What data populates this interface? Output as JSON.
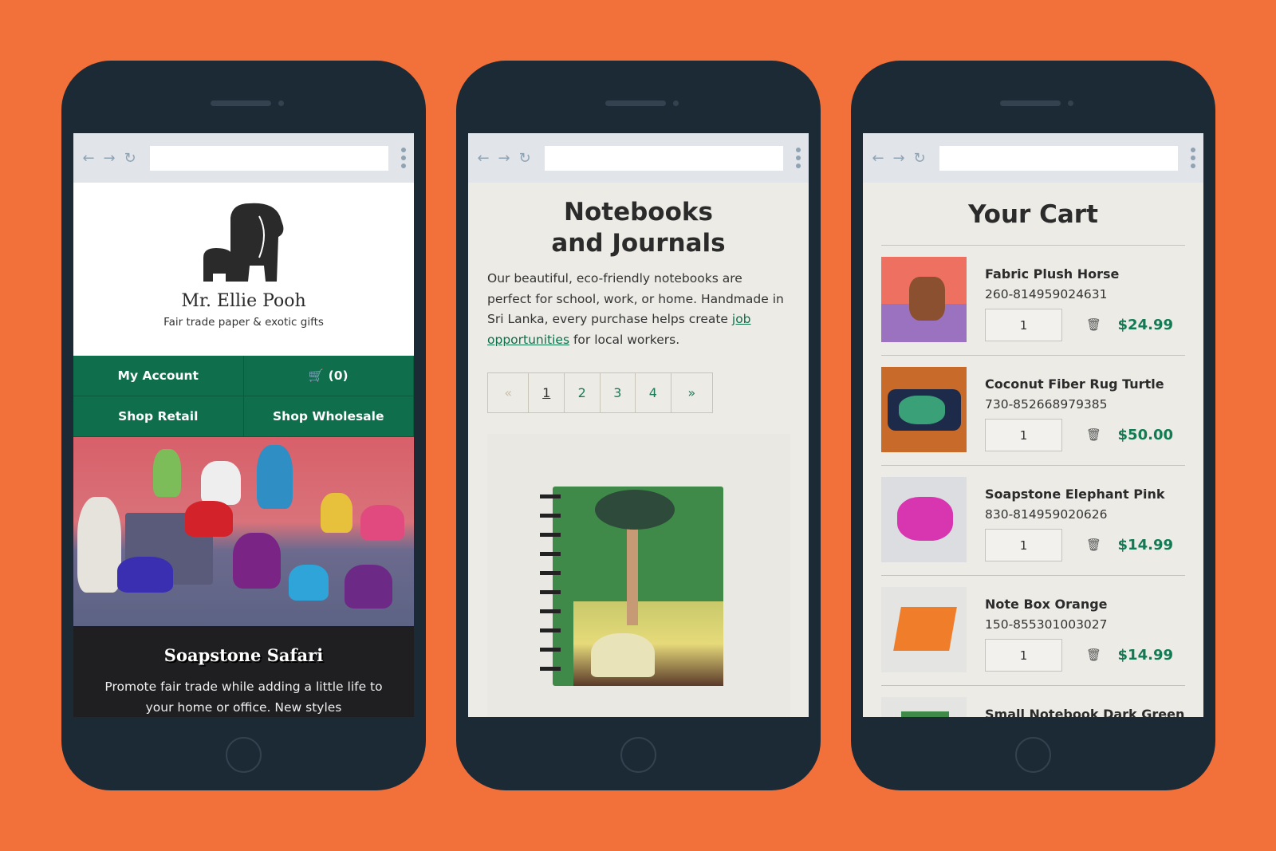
{
  "colors": {
    "background": "#f2703a",
    "phone": "#1c2a36",
    "brand_green": "#0f6e4c",
    "price_green": "#127a55"
  },
  "browser": {
    "back_icon": "arrow-left-icon",
    "forward_icon": "arrow-right-icon",
    "reload_icon": "reload-icon",
    "menu_icon": "kebab-menu-icon",
    "url": ""
  },
  "home": {
    "brand_name": "Mr. Ellie Pooh",
    "tagline": "Fair trade paper & exotic gifts",
    "nav": {
      "account": "My Account",
      "cart": "(0)",
      "shop_retail": "Shop Retail",
      "shop_wholesale": "Shop Wholesale"
    },
    "feature": {
      "title": "Soapstone Safari",
      "text": "Promote fair trade while adding a little life to your home or office. New styles"
    }
  },
  "category": {
    "title": "Notebooks and Journals",
    "description_before": "Our beautiful, eco-friendly notebooks are perfect for school, work, or home. Handmade in Sri Lanka, every purchase helps create ",
    "link_text": "job opportunities",
    "description_after": " for local workers.",
    "pagination": {
      "prev": "«",
      "pages": [
        "1",
        "2",
        "3",
        "4"
      ],
      "current": "1",
      "next": "»"
    }
  },
  "cart": {
    "title": "Your Cart",
    "items": [
      {
        "name": "Fabric Plush Horse",
        "sku": "260-814959024631",
        "qty": "1",
        "price": "$24.99"
      },
      {
        "name": "Coconut Fiber Rug Turtle",
        "sku": "730-852668979385",
        "qty": "1",
        "price": "$50.00"
      },
      {
        "name": "Soapstone Elephant Pink",
        "sku": "830-814959020626",
        "qty": "1",
        "price": "$14.99"
      },
      {
        "name": "Note Box Orange",
        "sku": "150-855301003027",
        "qty": "1",
        "price": "$14.99"
      },
      {
        "name": "Small Notebook Dark Green"
      }
    ]
  }
}
